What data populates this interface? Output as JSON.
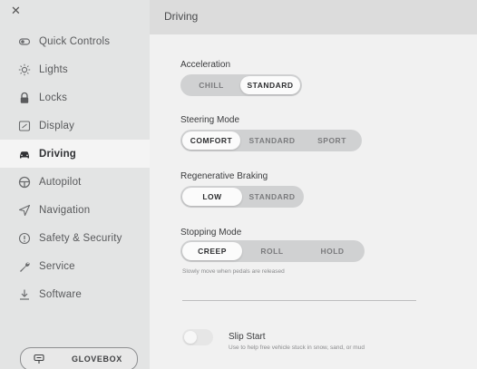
{
  "sidebar": {
    "close_glyph": "✕",
    "items": [
      {
        "label": "Quick Controls",
        "icon": "quick-controls-icon"
      },
      {
        "label": "Lights",
        "icon": "sun-icon"
      },
      {
        "label": "Locks",
        "icon": "lock-icon"
      },
      {
        "label": "Display",
        "icon": "display-icon"
      },
      {
        "label": "Driving",
        "icon": "car-icon",
        "active": true
      },
      {
        "label": "Autopilot",
        "icon": "steering-wheel-icon"
      },
      {
        "label": "Navigation",
        "icon": "navigation-arrow-icon"
      },
      {
        "label": "Safety & Security",
        "icon": "info-circle-icon"
      },
      {
        "label": "Service",
        "icon": "wrench-icon"
      },
      {
        "label": "Software",
        "icon": "download-icon"
      }
    ],
    "glovebox_label": "GLOVEBOX"
  },
  "main": {
    "title": "Driving",
    "acceleration": {
      "label": "Acceleration",
      "options": [
        "CHILL",
        "STANDARD"
      ],
      "selected": "STANDARD"
    },
    "steering_mode": {
      "label": "Steering Mode",
      "options": [
        "COMFORT",
        "STANDARD",
        "SPORT"
      ],
      "selected": "COMFORT"
    },
    "regen_braking": {
      "label": "Regenerative Braking",
      "options": [
        "LOW",
        "STANDARD"
      ],
      "selected": "LOW"
    },
    "stopping_mode": {
      "label": "Stopping Mode",
      "options": [
        "CREEP",
        "ROLL",
        "HOLD"
      ],
      "selected": "CREEP",
      "hint": "Slowly move when pedals are released"
    },
    "slip_start": {
      "title": "Slip Start",
      "description": "Use to help free vehicle stuck in snow, sand, or mud",
      "enabled": false
    }
  }
}
